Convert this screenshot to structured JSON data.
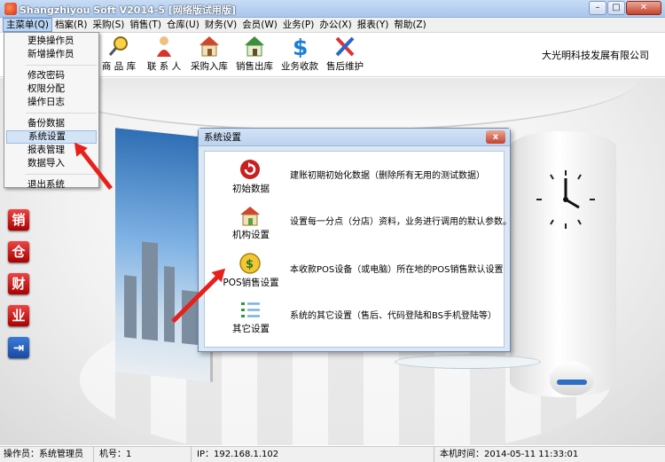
{
  "window": {
    "title": "Shangzhiyou Soft V2014-5 [网络版试用版]"
  },
  "menubar": [
    {
      "label": "主菜单(Q)"
    },
    {
      "label": "档案(R)"
    },
    {
      "label": "采购(S)"
    },
    {
      "label": "销售(T)"
    },
    {
      "label": "仓库(U)"
    },
    {
      "label": "财务(V)"
    },
    {
      "label": "会员(W)"
    },
    {
      "label": "业务(P)"
    },
    {
      "label": "办公(X)"
    },
    {
      "label": "报表(Y)"
    },
    {
      "label": "帮助(Z)"
    }
  ],
  "dropdown": [
    "更换操作员",
    "新增操作员",
    "修改密码",
    "权限分配",
    "操作日志",
    "备份数据",
    "系统设置",
    "报表管理",
    "数据导入",
    "退出系统"
  ],
  "toolbar": [
    {
      "label": "商 品 库",
      "icon": "magnifier-icon"
    },
    {
      "label": "联 系 人",
      "icon": "person-icon"
    },
    {
      "label": "采购入库",
      "icon": "house-icon"
    },
    {
      "label": "销售出库",
      "icon": "house-out-icon"
    },
    {
      "label": "业务收款",
      "icon": "dollar-icon"
    },
    {
      "label": "售后维护",
      "icon": "tools-icon"
    }
  ],
  "company": "大光明科技发展有限公司",
  "sidebar": [
    "销",
    "仓",
    "财",
    "业"
  ],
  "dialog": {
    "title": "系统设置",
    "close": "x",
    "options": [
      {
        "name": "初始数据",
        "desc": "建账初期初始化数据（删除所有无用的测试数据）"
      },
      {
        "name": "机构设置",
        "desc": "设置每一分点（分店）资料，业务进行调用的默认参数。"
      },
      {
        "name": "POS销售设置",
        "desc": "本收款POS设备（或电脑）所在地的POS销售默认设置"
      },
      {
        "name": "其它设置",
        "desc": "系统的其它设置（售后、代码登陆和BS手机登陆等）"
      }
    ]
  },
  "status": {
    "operator": "操作员：系统管理员",
    "machine": "机号：1",
    "ip": "IP：192.168.1.102",
    "time": "本机时间：2014-05-11 11:33:01"
  },
  "colors": {
    "accent": "#e8201c",
    "dialog_bg": "#dbe7f5",
    "titlebar": "#a9c6ec"
  }
}
